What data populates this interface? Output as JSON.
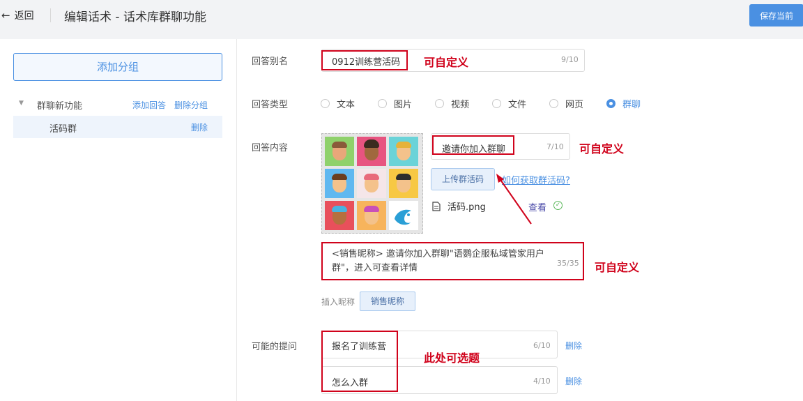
{
  "header": {
    "back_label": "返回",
    "title": "编辑话术 - 话术库群聊功能",
    "save_label": "保存当前"
  },
  "sidebar": {
    "add_group_label": "添加分组",
    "group": {
      "name": "群聊新功能",
      "add_reply_label": "添加回答",
      "delete_group_label": "删除分组"
    },
    "item": {
      "name": "活码群",
      "delete_label": "删除"
    }
  },
  "form": {
    "alias": {
      "label": "回答别名",
      "value": "0912训练营活码",
      "count": "9/10",
      "annotation": "可自定义"
    },
    "type": {
      "label": "回答类型",
      "options": [
        "文本",
        "图片",
        "视频",
        "文件",
        "网页",
        "群聊"
      ],
      "selected": "群聊"
    },
    "content": {
      "label": "回答内容",
      "group_name_value": "邀请你加入群聊",
      "group_name_count": "7/10",
      "group_name_annotation": "可自定义",
      "upload_label": "上传群活码",
      "how_to_label": "如何获取群活码?",
      "file_name": "活码.png",
      "view_label": "查看",
      "message_value": "<销售昵称>  邀请你加入群聊\"语鹦企服私域管家用户群\"，进入可查看详情",
      "message_count": "35/35",
      "message_annotation": "可自定义",
      "insert_label": "插入昵称",
      "nickname_button": "销售昵称"
    },
    "questions": {
      "label": "可能的提问",
      "items": [
        {
          "value": "报名了训练营",
          "count": "6/10",
          "delete_label": "删除"
        },
        {
          "value": "怎么入群",
          "count": "4/10",
          "delete_label": "删除"
        }
      ],
      "annotation": "此处可选题"
    }
  },
  "colors": {
    "accent": "#4a90e2",
    "annotation_red": "#d0021b"
  }
}
